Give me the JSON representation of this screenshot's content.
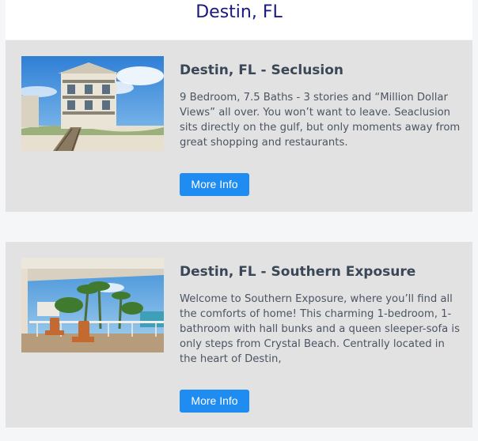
{
  "header": {
    "title": "Destin, FL"
  },
  "listings": [
    {
      "title": "Destin, FL - Seclusion",
      "description": "9 Bedroom, 7.5 Baths - 3 stories and “Million Dollar Views” all over. You won’t want to leave. Seaclusion sits directly on the gulf, but only moments away from great shopping and restaurants.",
      "button_label": "More Info"
    },
    {
      "title": "Destin, FL - Southern Exposure",
      "description": "Welcome to Southern Exposure, where you’ll find all the comforts of home! This charming 1-bedroom, 1-bathroom with hall bunks and a queen sleeper-sofa is only steps from Crystal Beach. Centrally located in the heart of Destin,",
      "button_label": "More Info"
    }
  ],
  "colors": {
    "accent": "#1f8cf1",
    "title_text": "#1a1a7c",
    "card_background": "#e3e2e2"
  }
}
